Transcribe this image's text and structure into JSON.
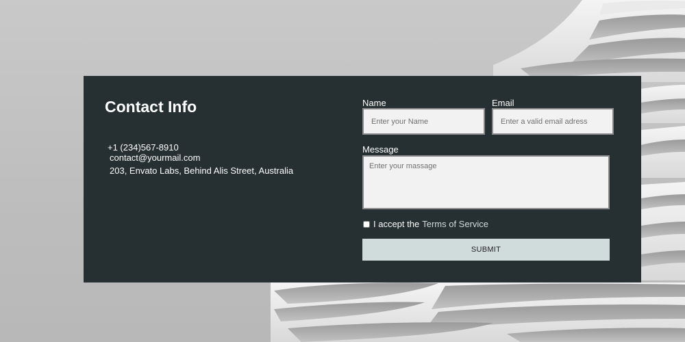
{
  "contact_info": {
    "title": "Contact Info",
    "phone": "+1 (234)567-8910",
    "email": "contact@yourmail.com",
    "address": "203, Envato Labs, Behind Alis Street, Australia"
  },
  "form": {
    "name_label": "Name",
    "name_placeholder": "Enter your Name",
    "email_label": "Email",
    "email_placeholder": "Enter a valid email adress",
    "message_label": "Message",
    "message_placeholder": "Enter your massage",
    "tos_prefix": "I accept the",
    "tos_link": "Terms of Service",
    "tos_checked": false,
    "submit_label": "SUBMIT"
  },
  "colors": {
    "card_background": "#263032",
    "submit_background": "#cfdcdb",
    "page_background": "#c4c4c4"
  }
}
